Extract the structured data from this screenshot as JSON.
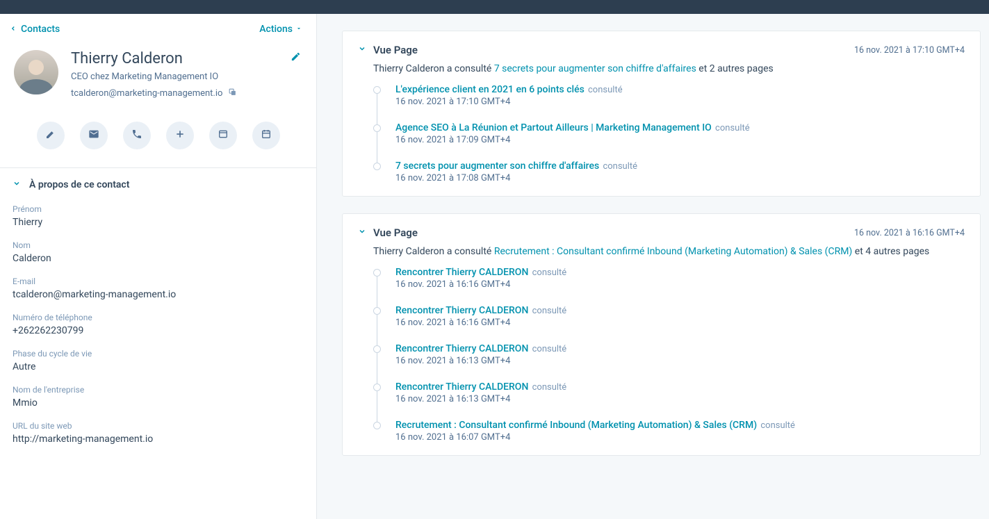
{
  "header": {
    "back_label": "Contacts",
    "actions_label": "Actions"
  },
  "contact": {
    "name": "Thierry Calderon",
    "subtitle": "CEO chez Marketing Management IO",
    "email": "tcalderon@marketing-management.io"
  },
  "about_section": {
    "title": "À propos de ce contact",
    "fields": [
      {
        "label": "Prénom",
        "value": "Thierry"
      },
      {
        "label": "Nom",
        "value": "Calderon"
      },
      {
        "label": "E-mail",
        "value": "tcalderon@marketing-management.io"
      },
      {
        "label": "Numéro de téléphone",
        "value": "+262262230799"
      },
      {
        "label": "Phase du cycle de vie",
        "value": "Autre"
      },
      {
        "label": "Nom de l'entreprise",
        "value": "Mmio"
      },
      {
        "label": "URL du site web",
        "value": "http://marketing-management.io"
      }
    ]
  },
  "activity_cards": [
    {
      "title": "Vue Page",
      "timestamp": "16 nov. 2021 à 17:10 GMT+4",
      "summary_prefix": "Thierry Calderon a consulté ",
      "summary_link": "7 secrets pour augmenter son chiffre d'affaires",
      "summary_suffix": " et 2 autres pages",
      "items": [
        {
          "title": "L'expérience client en 2021 en 6 points clés",
          "suffix": "consulté",
          "time": "16 nov. 2021 à 17:10 GMT+4"
        },
        {
          "title": "Agence SEO à La Réunion et Partout Ailleurs | Marketing Management IO",
          "suffix": "consulté",
          "time": "16 nov. 2021 à 17:09 GMT+4"
        },
        {
          "title": "7 secrets pour augmenter son chiffre d'affaires",
          "suffix": "consulté",
          "time": "16 nov. 2021 à 17:08 GMT+4"
        }
      ]
    },
    {
      "title": "Vue Page",
      "timestamp": "16 nov. 2021 à 16:16 GMT+4",
      "summary_prefix": "Thierry Calderon a consulté ",
      "summary_link": "Recrutement : Consultant confirmé Inbound (Marketing Automation) & Sales (CRM)",
      "summary_suffix": " et 4 autres pages",
      "items": [
        {
          "title": "Rencontrer Thierry CALDERON",
          "suffix": "consulté",
          "time": "16 nov. 2021 à 16:16 GMT+4"
        },
        {
          "title": "Rencontrer Thierry CALDERON",
          "suffix": "consulté",
          "time": "16 nov. 2021 à 16:16 GMT+4"
        },
        {
          "title": "Rencontrer Thierry CALDERON",
          "suffix": "consulté",
          "time": "16 nov. 2021 à 16:13 GMT+4"
        },
        {
          "title": "Rencontrer Thierry CALDERON",
          "suffix": "consulté",
          "time": "16 nov. 2021 à 16:13 GMT+4"
        },
        {
          "title": "Recrutement : Consultant confirmé Inbound (Marketing Automation) & Sales (CRM)",
          "suffix": "consulté",
          "time": "16 nov. 2021 à 16:07 GMT+4"
        }
      ]
    }
  ]
}
